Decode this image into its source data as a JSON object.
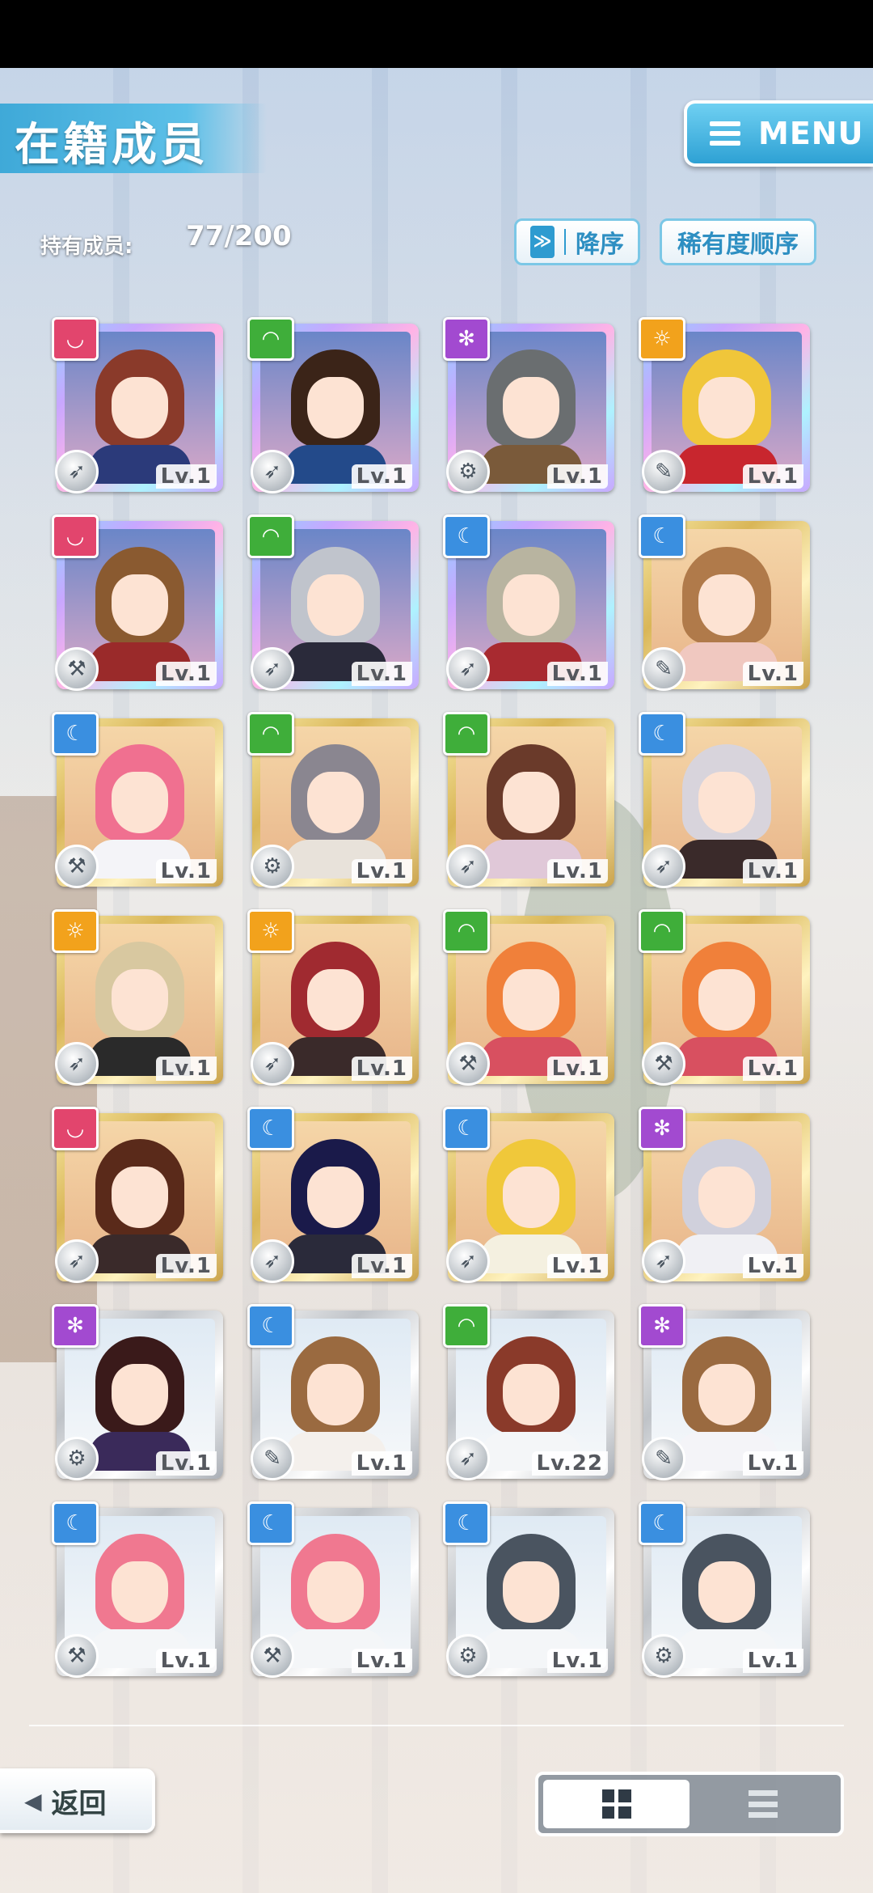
{
  "header": {
    "title": "在籍成员",
    "menu_label": "MENU"
  },
  "member_count": {
    "label": "持有成员:",
    "value": "77/200"
  },
  "sort": {
    "order_label": "降序",
    "order_icon": "≫",
    "rarity_label": "稀有度顺序"
  },
  "colors": {
    "accent": "#3fa9d8",
    "badge_pink": "#e2456d",
    "badge_green": "#3fae3a",
    "badge_purple": "#a24ad0",
    "badge_orange": "#f2a21c",
    "badge_blue": "#3a8fe0"
  },
  "cards": [
    {
      "badge": "pink",
      "badge_icon": "◡",
      "type_icon": "wrench-icon",
      "type_glyph": "➶",
      "level": "Lv.1",
      "frame": "rainbow",
      "hair": "#8a3a2a",
      "outfit": "#2b3a7a"
    },
    {
      "badge": "green",
      "badge_icon": "◠",
      "type_icon": "wrench-icon",
      "type_glyph": "➶",
      "level": "Lv.1",
      "frame": "rainbow",
      "hair": "#3b2418",
      "outfit": "#234a8a"
    },
    {
      "badge": "purple",
      "badge_icon": "✻",
      "type_icon": "gear-icon",
      "type_glyph": "⚙",
      "level": "Lv.1",
      "frame": "rainbow",
      "hair": "#6a6e70",
      "outfit": "#7a5a3a"
    },
    {
      "badge": "orange",
      "badge_icon": "☼",
      "type_icon": "pen-icon",
      "type_glyph": "✎",
      "level": "Lv.1",
      "frame": "rainbow",
      "hair": "#f0c63a",
      "outfit": "#c8262e"
    },
    {
      "badge": "pink",
      "badge_icon": "◡",
      "type_icon": "hammer-icon",
      "type_glyph": "⚒",
      "level": "Lv.1",
      "frame": "rainbow",
      "hair": "#8a5a30",
      "outfit": "#9a2a2a"
    },
    {
      "badge": "green",
      "badge_icon": "◠",
      "type_icon": "wrench-icon",
      "type_glyph": "➶",
      "level": "Lv.1",
      "frame": "rainbow",
      "hair": "#c0c4cc",
      "outfit": "#2a2a3a"
    },
    {
      "badge": "blue",
      "badge_icon": "☾",
      "type_icon": "wrench-icon",
      "type_glyph": "➶",
      "level": "Lv.1",
      "frame": "rainbow",
      "hair": "#b8b4a0",
      "outfit": "#a82a30"
    },
    {
      "badge": "blue",
      "badge_icon": "☾",
      "type_icon": "pen-icon",
      "type_glyph": "✎",
      "level": "Lv.1",
      "frame": "gold",
      "hair": "#b07a4a",
      "outfit": "#f0c8c0"
    },
    {
      "badge": "blue",
      "badge_icon": "☾",
      "type_icon": "hammer-icon",
      "type_glyph": "⚒",
      "level": "Lv.1",
      "frame": "gold",
      "hair": "#f07090",
      "outfit": "#f4f4f8"
    },
    {
      "badge": "green",
      "badge_icon": "◠",
      "type_icon": "gear-icon",
      "type_glyph": "⚙",
      "level": "Lv.1",
      "frame": "gold",
      "hair": "#8a8690",
      "outfit": "#e8e2da"
    },
    {
      "badge": "green",
      "badge_icon": "◠",
      "type_icon": "wrench-icon",
      "type_glyph": "➶",
      "level": "Lv.1",
      "frame": "gold",
      "hair": "#6a3a2a",
      "outfit": "#e0c8d8"
    },
    {
      "badge": "blue",
      "badge_icon": "☾",
      "type_icon": "wrench-icon",
      "type_glyph": "➶",
      "level": "Lv.1",
      "frame": "gold",
      "hair": "#d8d4dc",
      "outfit": "#3a2a2a"
    },
    {
      "badge": "orange",
      "badge_icon": "☼",
      "type_icon": "wrench-icon",
      "type_glyph": "➶",
      "level": "Lv.1",
      "frame": "gold",
      "hair": "#d8c8a0",
      "outfit": "#2a2a2a"
    },
    {
      "badge": "orange",
      "badge_icon": "☼",
      "type_icon": "wrench-icon",
      "type_glyph": "➶",
      "level": "Lv.1",
      "frame": "gold",
      "hair": "#a02a30",
      "outfit": "#3a2a2a"
    },
    {
      "badge": "green",
      "badge_icon": "◠",
      "type_icon": "hammer-icon",
      "type_glyph": "⚒",
      "level": "Lv.1",
      "frame": "gold",
      "hair": "#f0803a",
      "outfit": "#d85060"
    },
    {
      "badge": "green",
      "badge_icon": "◠",
      "type_icon": "hammer-icon",
      "type_glyph": "⚒",
      "level": "Lv.1",
      "frame": "gold",
      "hair": "#f0803a",
      "outfit": "#d85060"
    },
    {
      "badge": "pink",
      "badge_icon": "◡",
      "type_icon": "wrench-icon",
      "type_glyph": "➶",
      "level": "Lv.1",
      "frame": "gold",
      "hair": "#5a2a1a",
      "outfit": "#3a2a2a"
    },
    {
      "badge": "blue",
      "badge_icon": "☾",
      "type_icon": "wrench-icon",
      "type_glyph": "➶",
      "level": "Lv.1",
      "frame": "gold",
      "hair": "#1a1a4a",
      "outfit": "#2a2a3a"
    },
    {
      "badge": "blue",
      "badge_icon": "☾",
      "type_icon": "wrench-icon",
      "type_glyph": "➶",
      "level": "Lv.1",
      "frame": "gold",
      "hair": "#f0c83a",
      "outfit": "#f4f0e0"
    },
    {
      "badge": "purple",
      "badge_icon": "✻",
      "type_icon": "wrench-icon",
      "type_glyph": "➶",
      "level": "Lv.1",
      "frame": "gold",
      "hair": "#d0d0dc",
      "outfit": "#f0f0f4"
    },
    {
      "badge": "purple",
      "badge_icon": "✻",
      "type_icon": "gear-icon",
      "type_glyph": "⚙",
      "level": "Lv.1",
      "frame": "silver",
      "hair": "#3a1a1a",
      "outfit": "#3a2a5a"
    },
    {
      "badge": "blue",
      "badge_icon": "☾",
      "type_icon": "pen-icon",
      "type_glyph": "✎",
      "level": "Lv.1",
      "frame": "silver",
      "hair": "#9a6a40",
      "outfit": "#f4f0ec"
    },
    {
      "badge": "green",
      "badge_icon": "◠",
      "type_icon": "wrench-icon",
      "type_glyph": "➶",
      "level": "Lv.22",
      "frame": "silver",
      "hair": "#8a3a2a",
      "outfit": "#f4f6f8"
    },
    {
      "badge": "purple",
      "badge_icon": "✻",
      "type_icon": "pen-icon",
      "type_glyph": "✎",
      "level": "Lv.1",
      "frame": "silver",
      "hair": "#9a6a40",
      "outfit": "#f4f4f8"
    },
    {
      "badge": "blue",
      "badge_icon": "☾",
      "type_icon": "hammer-icon",
      "type_glyph": "⚒",
      "level": "Lv.1",
      "frame": "silver",
      "hair": "#f07890",
      "outfit": "#f4f6f8"
    },
    {
      "badge": "blue",
      "badge_icon": "☾",
      "type_icon": "hammer-icon",
      "type_glyph": "⚒",
      "level": "Lv.1",
      "frame": "silver",
      "hair": "#f07890",
      "outfit": "#f4f6f8"
    },
    {
      "badge": "blue",
      "badge_icon": "☾",
      "type_icon": "gear-icon",
      "type_glyph": "⚙",
      "level": "Lv.1",
      "frame": "silver",
      "hair": "#4a5460",
      "outfit": "#f4f6f8"
    },
    {
      "badge": "blue",
      "badge_icon": "☾",
      "type_icon": "gear-icon",
      "type_glyph": "⚙",
      "level": "Lv.1",
      "frame": "silver",
      "hair": "#4a5460",
      "outfit": "#f4f6f8"
    }
  ],
  "footer": {
    "back_label": "返回",
    "view_modes": [
      "grid",
      "list"
    ]
  }
}
